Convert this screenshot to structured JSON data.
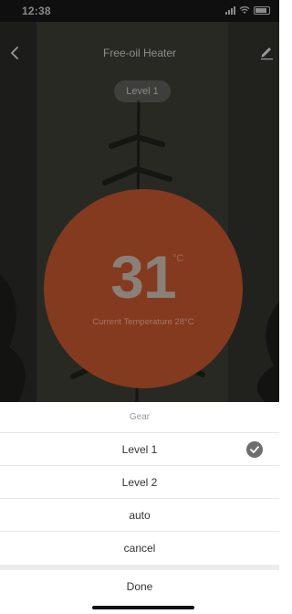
{
  "status_bar": {
    "time": "12:38"
  },
  "nav": {
    "title": "Free-oil Heater",
    "back_icon": "chevron-left-icon",
    "edit_icon": "pencil-icon"
  },
  "gear_pill": {
    "label": "Level 1"
  },
  "thermostat": {
    "set_temperature": "31",
    "unit": "°C",
    "current_label": "Current Temperature 28°C",
    "circle_color": "#833a1f"
  },
  "sheet": {
    "title": "Gear",
    "options": [
      {
        "label": "Level 1",
        "selected": true
      },
      {
        "label": "Level 2",
        "selected": false
      },
      {
        "label": "auto",
        "selected": false
      },
      {
        "label": "cancel",
        "selected": false
      }
    ],
    "done_label": "Done",
    "check_icon": "checkmark-circle-icon"
  }
}
